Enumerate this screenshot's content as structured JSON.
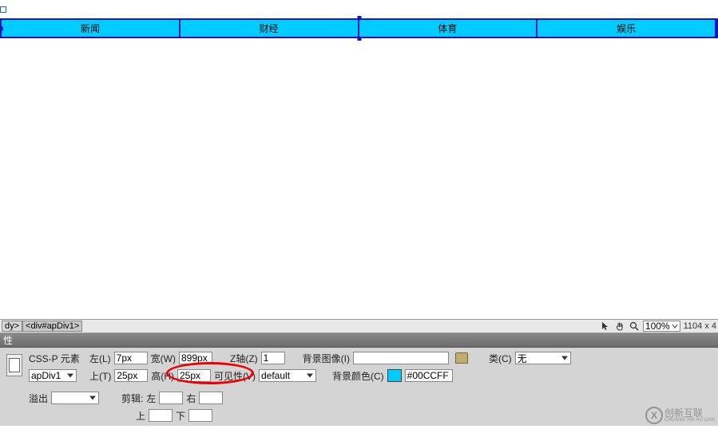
{
  "nav": {
    "items": [
      "新闻",
      "财经",
      "体育",
      "娱乐"
    ]
  },
  "tagbar": {
    "left_tags": [
      "dy>",
      "<div#apDiv1>"
    ],
    "zoom": "100%",
    "dimensions": "1104 x 4"
  },
  "panel": {
    "title": "性",
    "section_label": "CSS-P 元素",
    "element_id": "apDiv1",
    "left": {
      "label": "左(L)",
      "value": "7px"
    },
    "width": {
      "label": "宽(W)",
      "value": "899px"
    },
    "zaxis": {
      "label": "Z轴(Z)",
      "value": "1"
    },
    "bgimage": {
      "label": "背景图像(I)",
      "value": ""
    },
    "class": {
      "label": "类(C)",
      "value": "无"
    },
    "top": {
      "label": "上(T)",
      "value": "25px"
    },
    "height": {
      "label": "高(H)",
      "value": "25px"
    },
    "visibility": {
      "label": "可见性(V)",
      "value": "default"
    },
    "bgcolor": {
      "label": "背景颜色(C)",
      "value": "#00CCFF"
    },
    "overflow": {
      "label": "溢出"
    },
    "clip": {
      "label": "剪辑:",
      "left_l": "左",
      "right_l": "右",
      "top_l": "上",
      "bottom_l": "下"
    }
  },
  "watermark": {
    "icon": "X",
    "line1": "创新互联",
    "line2": "CHUANG XIN HU LIAN"
  }
}
